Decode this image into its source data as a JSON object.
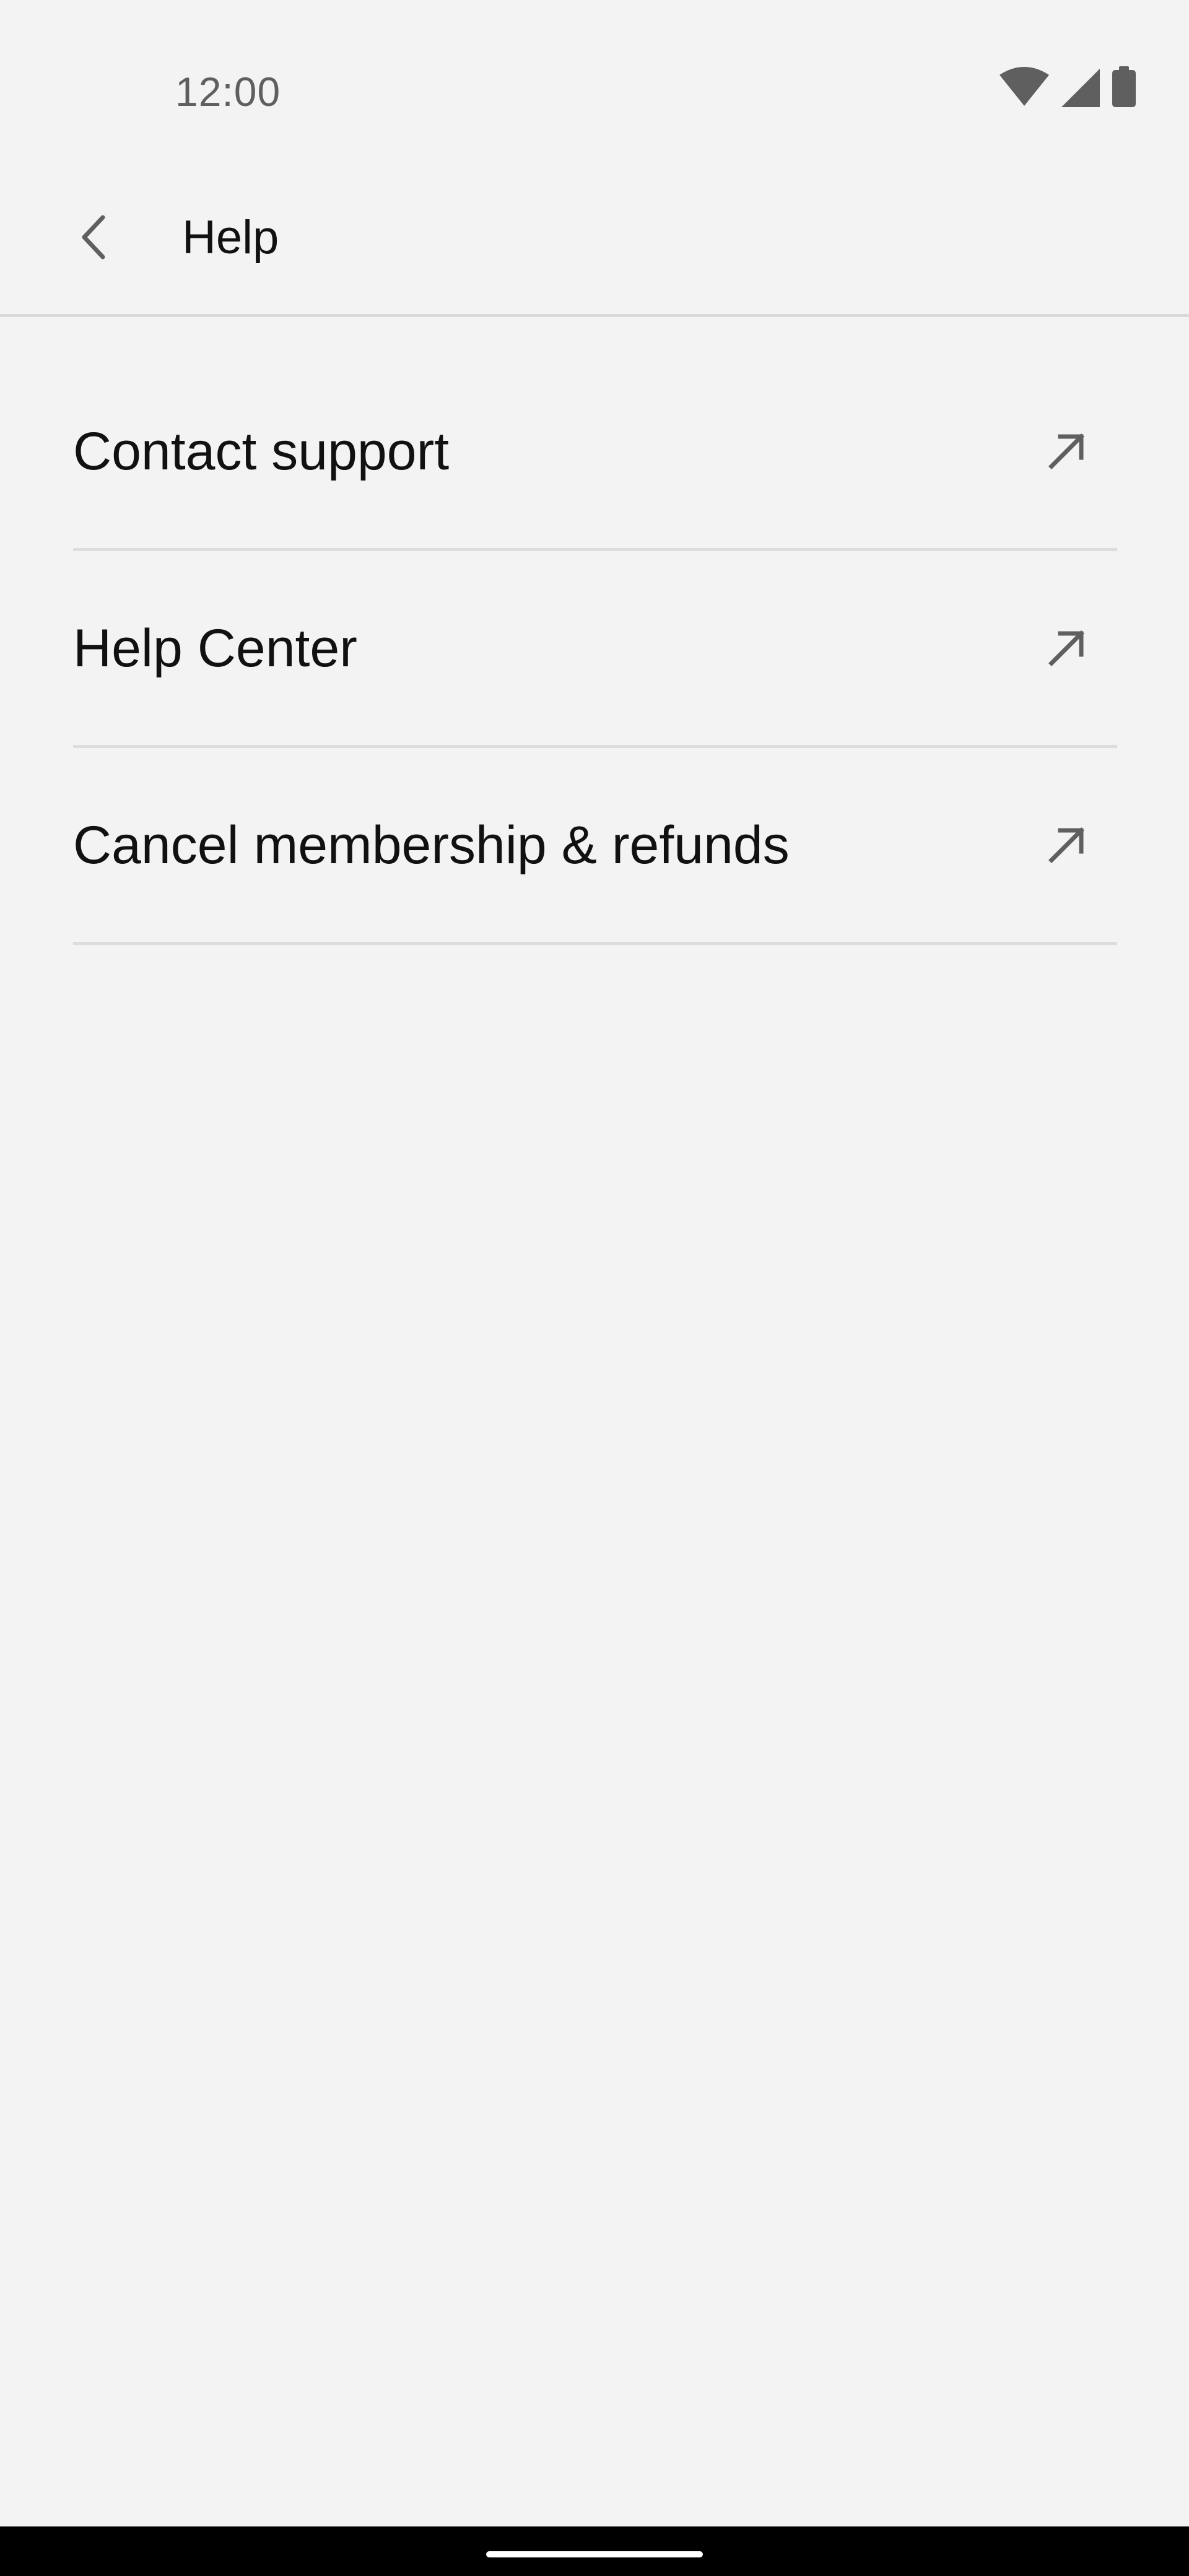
{
  "status_bar": {
    "time": "12:00",
    "icons": [
      "wifi-icon",
      "cellular-signal-icon",
      "battery-icon"
    ]
  },
  "app_bar": {
    "back_icon": "chevron-left-icon",
    "title": "Help"
  },
  "menu": {
    "items": [
      {
        "label": "Contact support",
        "icon": "external-link-arrow-icon"
      },
      {
        "label": "Help Center",
        "icon": "external-link-arrow-icon"
      },
      {
        "label": "Cancel membership & refunds",
        "icon": "external-link-arrow-icon"
      }
    ]
  },
  "colors": {
    "background": "#f3f3f3",
    "text": "#111111",
    "icon": "#5f5f5f",
    "divider": "#dcdcdc",
    "nav_bar": "#000000"
  }
}
